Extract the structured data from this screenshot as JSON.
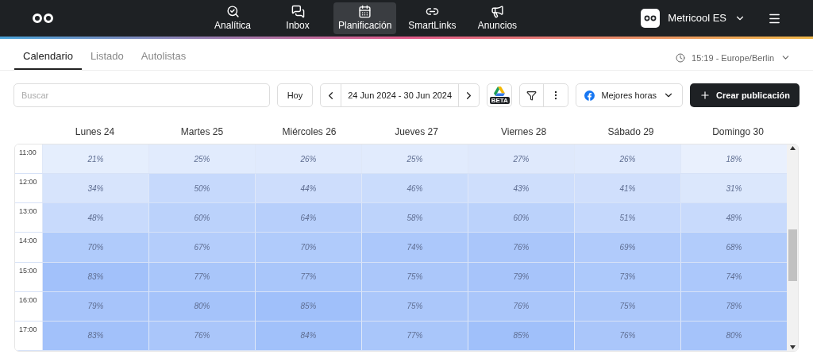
{
  "nav": {
    "items": [
      {
        "label": "Analítica",
        "selected": false
      },
      {
        "label": "Inbox",
        "selected": false
      },
      {
        "label": "Planificación",
        "selected": true
      },
      {
        "label": "SmartLinks",
        "selected": false
      },
      {
        "label": "Anuncios",
        "selected": false
      }
    ],
    "account": "Metricool ES"
  },
  "tabs": [
    {
      "label": "Calendario",
      "selected": true
    },
    {
      "label": "Listado",
      "selected": false
    },
    {
      "label": "Autolistas",
      "selected": false
    }
  ],
  "timezone": "15:19 - Europe/Berlin",
  "toolbar": {
    "search_placeholder": "Buscar",
    "today": "Hoy",
    "date_range": "24 Jun 2024 - 30 Jun 2024",
    "beta_badge": "BETA",
    "best_hours": "Mejores horas",
    "create": "Crear publicación"
  },
  "calendar": {
    "days": [
      "Lunes 24",
      "Martes 25",
      "Miércoles 26",
      "Jueves 27",
      "Viernes 28",
      "Sábado 29",
      "Domingo 30"
    ],
    "rows": [
      {
        "time": "11:00",
        "cells": [
          {
            "text": "21%",
            "color": "#e5eefd"
          },
          {
            "text": "25%",
            "color": "#e1ebfd"
          },
          {
            "text": "26%",
            "color": "#e0eafd"
          },
          {
            "text": "25%",
            "color": "#e1ebfd"
          },
          {
            "text": "27%",
            "color": "#dfe9fc"
          },
          {
            "text": "26%",
            "color": "#e0eafd"
          },
          {
            "text": "18%",
            "color": "#e9f0fd"
          }
        ]
      },
      {
        "time": "12:00",
        "cells": [
          {
            "text": "34%",
            "color": "#d7e4fc"
          },
          {
            "text": "50%",
            "color": "#c6d9fc"
          },
          {
            "text": "44%",
            "color": "#cdddfc"
          },
          {
            "text": "46%",
            "color": "#cadcfc"
          },
          {
            "text": "43%",
            "color": "#cedefc"
          },
          {
            "text": "41%",
            "color": "#d0dffc"
          },
          {
            "text": "31%",
            "color": "#dbe7fc"
          }
        ]
      },
      {
        "time": "13:00",
        "cells": [
          {
            "text": "48%",
            "color": "#c8dafc"
          },
          {
            "text": "60%",
            "color": "#bbd2fb"
          },
          {
            "text": "64%",
            "color": "#b7cffb"
          },
          {
            "text": "58%",
            "color": "#bdd3fb"
          },
          {
            "text": "60%",
            "color": "#bbd2fb"
          },
          {
            "text": "51%",
            "color": "#c5d8fc"
          },
          {
            "text": "48%",
            "color": "#c8dafc"
          }
        ]
      },
      {
        "time": "14:00",
        "cells": [
          {
            "text": "70%",
            "color": "#b0cbfb"
          },
          {
            "text": "67%",
            "color": "#b4cdfb"
          },
          {
            "text": "70%",
            "color": "#b0cbfb"
          },
          {
            "text": "74%",
            "color": "#acc8fb"
          },
          {
            "text": "76%",
            "color": "#aac6fa"
          },
          {
            "text": "69%",
            "color": "#b1cbfb"
          },
          {
            "text": "68%",
            "color": "#b2ccfb"
          }
        ]
      },
      {
        "time": "15:00",
        "cells": [
          {
            "text": "83%",
            "color": "#a2c1fa"
          },
          {
            "text": "77%",
            "color": "#a9c6fa"
          },
          {
            "text": "77%",
            "color": "#a9c6fa"
          },
          {
            "text": "75%",
            "color": "#abc7fa"
          },
          {
            "text": "79%",
            "color": "#a7c4fa"
          },
          {
            "text": "73%",
            "color": "#adc9fb"
          },
          {
            "text": "74%",
            "color": "#acc8fb"
          }
        ]
      },
      {
        "time": "16:00",
        "cells": [
          {
            "text": "79%",
            "color": "#a7c4fa"
          },
          {
            "text": "80%",
            "color": "#a5c3fa"
          },
          {
            "text": "85%",
            "color": "#a0c0fa"
          },
          {
            "text": "75%",
            "color": "#abc7fa"
          },
          {
            "text": "76%",
            "color": "#aac6fa"
          },
          {
            "text": "75%",
            "color": "#abc7fa"
          },
          {
            "text": "78%",
            "color": "#a8c5fa"
          }
        ]
      },
      {
        "time": "17:00",
        "cells": [
          {
            "text": "83%",
            "color": "#a2c1fa"
          },
          {
            "text": "76%",
            "color": "#aac6fa"
          },
          {
            "text": "84%",
            "color": "#a1c1fa"
          },
          {
            "text": "77%",
            "color": "#a9c6fa"
          },
          {
            "text": "85%",
            "color": "#a0c0fa"
          },
          {
            "text": "76%",
            "color": "#aac6fa"
          },
          {
            "text": "80%",
            "color": "#a5c3fa"
          }
        ]
      }
    ]
  }
}
